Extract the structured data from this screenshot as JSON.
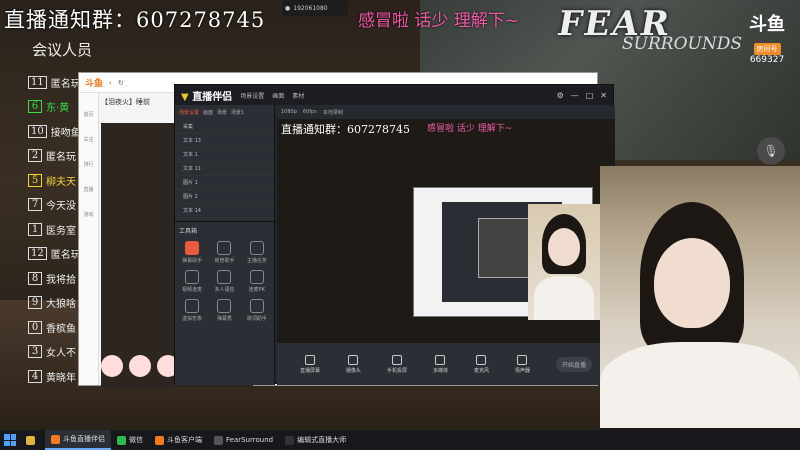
{
  "stream": {
    "headline": "直播通知群：607278745",
    "mood": "感冒啦 话少 理解下~",
    "top_id": "192061080"
  },
  "game_logo": {
    "line1": "FEAR",
    "line2": "SURROUNDS"
  },
  "platform": {
    "name": "斗鱼",
    "tag": "房间号",
    "room": "669327"
  },
  "sidebar": {
    "title": "会议人员",
    "members": [
      {
        "n": "11",
        "t": "匿名玩",
        "c": ""
      },
      {
        "n": "6",
        "t": "东·黄",
        "c": "g"
      },
      {
        "n": "10",
        "t": "接吻鱼",
        "c": ""
      },
      {
        "n": "2",
        "t": "匿名玩",
        "c": ""
      },
      {
        "n": "5",
        "t": "柳夫天",
        "c": "y"
      },
      {
        "n": "7",
        "t": "今天没",
        "c": ""
      },
      {
        "n": "1",
        "t": "医务室",
        "c": ""
      },
      {
        "n": "12",
        "t": "匿名玩",
        "c": ""
      },
      {
        "n": "8",
        "t": "我将拾",
        "c": ""
      },
      {
        "n": "9",
        "t": "大狼啥",
        "c": ""
      },
      {
        "n": "0",
        "t": "香槟鱼",
        "c": ""
      },
      {
        "n": "3",
        "t": "女人不",
        "c": ""
      },
      {
        "n": "4",
        "t": "黄晓年",
        "c": ""
      }
    ]
  },
  "back_window": {
    "brand": "斗鱼",
    "room_title": "【泪夜火】睡前",
    "side": [
      "首页",
      "关注",
      "排行",
      "直播",
      "游戏"
    ],
    "side_btn": "开播"
  },
  "front_window": {
    "brand": "直播伴侣",
    "menu": [
      "场景设置",
      "画面",
      "素材"
    ],
    "tabs": [
      "场景设置",
      "画面",
      "场景",
      "场景1"
    ],
    "scenes": [
      "采集",
      "文本 13",
      "文本 1",
      "文本 11",
      "图片 1",
      "图片 2",
      "文本 14",
      "图片 28"
    ],
    "tools_head": "工具箱",
    "tools": [
      "弹幕助手",
      "房管助手",
      "主播任务",
      "视频连麦",
      "多人语音",
      "连麦PK",
      "虚拟形象",
      "弹幕秀",
      "歌词助手"
    ],
    "preview_info": [
      "1080p",
      "60fps",
      "本地录制"
    ],
    "bottom": [
      "直播屏幕",
      "摄像头",
      "手机投屏",
      "多媒体",
      "麦克风",
      "扬声器"
    ],
    "golive": "开始直播"
  },
  "taskbar": {
    "items": [
      "斗鱼直播伴侣",
      "微信",
      "斗鱼客户端",
      "FearSurround",
      "编辑式直播大师"
    ]
  },
  "colors": {
    "accent": "#f15aa7",
    "brand": "#f47920"
  }
}
